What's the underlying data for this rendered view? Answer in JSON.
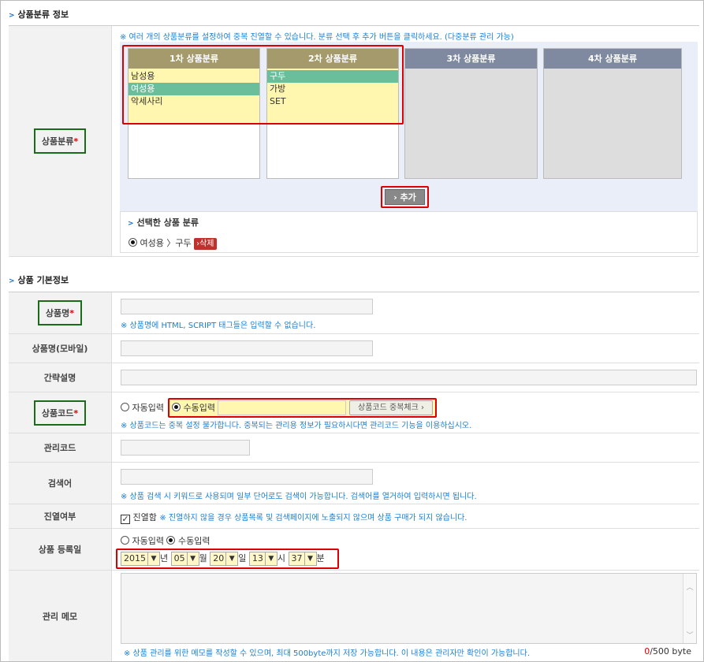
{
  "section1": {
    "title": "상품분류 정보",
    "note": "※ 여러 개의 상품분류를 설정하여 중복 진열할 수 있습니다. 분류 선택 후 추가 버튼을 클릭하세요. (다중분류 관리 가능)",
    "label": "상품분류",
    "required_mark": "*",
    "columns": [
      {
        "header": "1차 상품분류",
        "items": [
          "남성용",
          "여성용",
          "악세사리"
        ],
        "selected": 1
      },
      {
        "header": "2차 상품분류",
        "items": [
          "구두",
          "가방",
          "SET"
        ],
        "selected": 0
      },
      {
        "header": "3차 상품분류",
        "items": []
      },
      {
        "header": "4차 상품분류",
        "items": []
      }
    ],
    "add_button": "› 추가",
    "selected_title": "선택한 상품 분류",
    "selected_path": "여성용 〉구두",
    "delete_button": "›삭제"
  },
  "section2": {
    "title": "상품 기본정보",
    "name_label": "상품명",
    "name_note": "※ 상품명에 HTML, SCRIPT 태그들은 입력할 수 없습니다.",
    "mobile_label": "상품명(모바일)",
    "summary_label": "간략설명",
    "code_label": "상품코드",
    "code_auto": "자동입력",
    "code_manual": "수동입력",
    "code_check_button": "상품코드 중복체크 ›",
    "code_note": "※ 상품코드는 중복 설정 불가합니다. 중복되는 관리용 정보가 필요하시다면 관리코드 기능을 이용하십시오.",
    "manage_code_label": "관리코드",
    "search_label": "검색어",
    "search_note": "※ 상품 검색 시 키워드로 사용되며 일부 단어로도 검색이 가능합니다. 검색어를 열거하여 입력하시면 됩니다.",
    "display_label": "진열여부",
    "display_check": "진열함",
    "display_note": "※ 진열하지 않을 경우 상품목록 및 검색페이지에 노출되지 않으며 상품 구매가 되지 않습니다.",
    "regdate_label": "상품 등록일",
    "regdate_auto": "자동입력",
    "regdate_manual": "수동입력",
    "date": {
      "year": "2015",
      "y_unit": "년",
      "month": "05",
      "m_unit": "월",
      "day": "20",
      "d_unit": "일",
      "hour": "13",
      "h_unit": "시",
      "minute": "37",
      "min_unit": "분"
    },
    "memo_label": "관리 메모",
    "memo_note": "※ 상품 관리를 위한 메모를 작성할 수 있으며, 최대 500byte까지 저장 가능합니다. 이 내용은 관리자만 확인이 가능합니다.",
    "memo_count": "0",
    "memo_max": "/500 byte"
  },
  "colors": {
    "accent": "#1a7fd4",
    "required": "#dd0000",
    "highlight": "#d00000",
    "label_border": "#1a6b1a"
  }
}
